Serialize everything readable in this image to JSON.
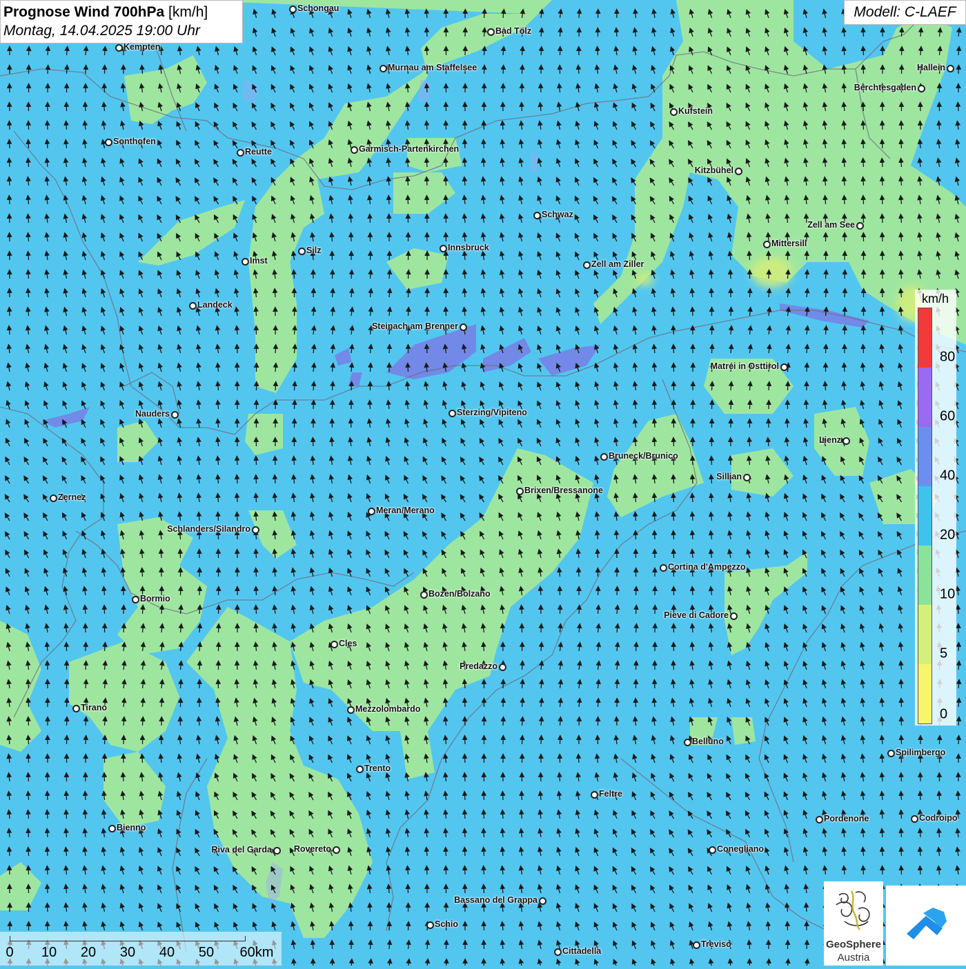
{
  "header": {
    "title_bold": "Prognose Wind 700hPa",
    "title_unit": "[km/h]",
    "subtitle": "Montag, 14.04.2025 19:00 Uhr"
  },
  "model_label": "Modell: C-LAEF",
  "legend": {
    "unit": "km/h",
    "ticks": [
      "80",
      "60",
      "40",
      "20",
      "10",
      "5",
      "0"
    ],
    "colors": [
      "#f23a3a",
      "#9a6bf0",
      "#6b8ff0",
      "#3fc3ee",
      "#8ae39a",
      "#d5f07a",
      "#f7f56a"
    ]
  },
  "scale_bar": {
    "ticks": [
      "0",
      "10",
      "20",
      "30",
      "40",
      "50",
      "60km"
    ]
  },
  "logos": {
    "geosphere_name": "GeoSphere",
    "geosphere_sub": "Austria"
  },
  "colors": {
    "wind_10_20": "#9ee6a0",
    "wind_20_40": "#53c6f0",
    "wind_40_60": "#7a7ae6",
    "wind_5_10": "#d5ee7a",
    "arrow": "#1a1a1a"
  },
  "cities": [
    {
      "name": "Schongau",
      "pos": [
        424,
        13
      ],
      "side": "r"
    },
    {
      "name": "Bad Tölz",
      "pos": [
        711,
        46
      ],
      "side": "r"
    },
    {
      "name": "Kempten",
      "pos": [
        172,
        69
      ],
      "side": "r"
    },
    {
      "name": "Murnau am Staffelsee",
      "pos": [
        555,
        99
      ],
      "side": "r"
    },
    {
      "name": "Hallein",
      "pos": [
        1377,
        99
      ],
      "side": "l"
    },
    {
      "name": "Berchtesgaden",
      "pos": [
        1335,
        128
      ],
      "side": "l"
    },
    {
      "name": "Kufstein",
      "pos": [
        976,
        162
      ],
      "side": "r"
    },
    {
      "name": "Sonthofen",
      "pos": [
        157,
        206
      ],
      "side": "r"
    },
    {
      "name": "Reutte",
      "pos": [
        348,
        221
      ],
      "side": "r"
    },
    {
      "name": "Garmisch-Partenkirchen",
      "pos": [
        513,
        217
      ],
      "side": "r"
    },
    {
      "name": "Kitzbühel",
      "pos": [
        1070,
        248
      ],
      "side": "l"
    },
    {
      "name": "Schwaz",
      "pos": [
        778,
        312
      ],
      "side": "r"
    },
    {
      "name": "Zell am See",
      "pos": [
        1246,
        327
      ],
      "side": "l"
    },
    {
      "name": "Mittersill",
      "pos": [
        1111,
        354
      ],
      "side": "r"
    },
    {
      "name": "Innsbruck",
      "pos": [
        642,
        360
      ],
      "side": "r"
    },
    {
      "name": "Silz",
      "pos": [
        437,
        364
      ],
      "side": "r"
    },
    {
      "name": "Imst",
      "pos": [
        355,
        379
      ],
      "side": "r"
    },
    {
      "name": "Zell am Ziller",
      "pos": [
        850,
        384
      ],
      "side": "r"
    },
    {
      "name": "Landeck",
      "pos": [
        279,
        443
      ],
      "side": "r"
    },
    {
      "name": "Steinach am Brenner",
      "pos": [
        671,
        474
      ],
      "side": "l"
    },
    {
      "name": "Matrei in Osttirol",
      "pos": [
        1136,
        532
      ],
      "side": "l"
    },
    {
      "name": "Nauders",
      "pos": [
        253,
        601
      ],
      "side": "l"
    },
    {
      "name": "Sterzing/Vipiteno",
      "pos": [
        655,
        599
      ],
      "side": "r"
    },
    {
      "name": "Lienz",
      "pos": [
        1226,
        639
      ],
      "side": "l"
    },
    {
      "name": "Bruneck/Brunico",
      "pos": [
        875,
        662
      ],
      "side": "r"
    },
    {
      "name": "Sillian",
      "pos": [
        1082,
        692
      ],
      "side": "l"
    },
    {
      "name": "Brixen/Bressanone",
      "pos": [
        753,
        712
      ],
      "side": "r"
    },
    {
      "name": "Zernez",
      "pos": [
        77,
        722
      ],
      "side": "r"
    },
    {
      "name": "Meran/Merano",
      "pos": [
        538,
        741
      ],
      "side": "r"
    },
    {
      "name": "Schlanders/Silandro",
      "pos": [
        370,
        768
      ],
      "side": "l"
    },
    {
      "name": "Cortina d'Ampezzo",
      "pos": [
        961,
        823
      ],
      "side": "r"
    },
    {
      "name": "Bozen/Bolzano",
      "pos": [
        614,
        862
      ],
      "side": "r"
    },
    {
      "name": "Bormio",
      "pos": [
        196,
        869
      ],
      "side": "r"
    },
    {
      "name": "Pieve di Cadore",
      "pos": [
        1063,
        893
      ],
      "side": "l"
    },
    {
      "name": "Cles",
      "pos": [
        484,
        934
      ],
      "side": "r"
    },
    {
      "name": "Predazzo",
      "pos": [
        728,
        967
      ],
      "side": "l"
    },
    {
      "name": "Tirano",
      "pos": [
        110,
        1027
      ],
      "side": "r"
    },
    {
      "name": "Mezzolombardo",
      "pos": [
        508,
        1029
      ],
      "side": "r"
    },
    {
      "name": "Belluno",
      "pos": [
        996,
        1076
      ],
      "side": "r"
    },
    {
      "name": "Spilimbergo",
      "pos": [
        1291,
        1092
      ],
      "side": "r"
    },
    {
      "name": "Trento",
      "pos": [
        521,
        1115
      ],
      "side": "r"
    },
    {
      "name": "Feltre",
      "pos": [
        861,
        1152
      ],
      "side": "r"
    },
    {
      "name": "Pordenone",
      "pos": [
        1187,
        1188
      ],
      "side": "r"
    },
    {
      "name": "Codroipo",
      "pos": [
        1325,
        1187
      ],
      "side": "r"
    },
    {
      "name": "Bienno",
      "pos": [
        162,
        1201
      ],
      "side": "r"
    },
    {
      "name": "Riva del Garda",
      "pos": [
        401,
        1233
      ],
      "side": "l"
    },
    {
      "name": "Rovereto",
      "pos": [
        487,
        1232
      ],
      "side": "l"
    },
    {
      "name": "Conegliano",
      "pos": [
        1032,
        1232
      ],
      "side": "r"
    },
    {
      "name": "Bassano del Grappa",
      "pos": [
        786,
        1306
      ],
      "side": "l"
    },
    {
      "name": "Schio",
      "pos": [
        623,
        1341
      ],
      "side": "r"
    },
    {
      "name": "Treviso",
      "pos": [
        1009,
        1370
      ],
      "side": "r"
    },
    {
      "name": "Cittadella",
      "pos": [
        808,
        1380
      ],
      "side": "r"
    }
  ]
}
